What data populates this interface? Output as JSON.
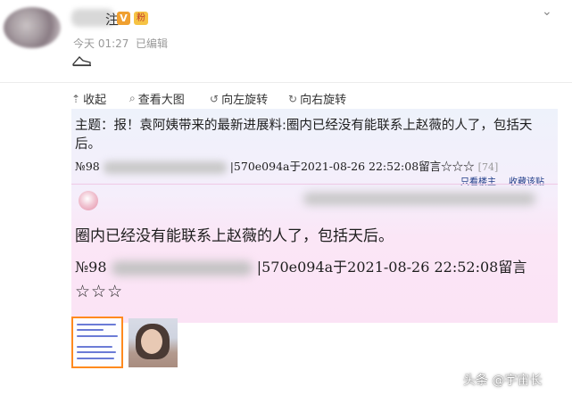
{
  "header": {
    "username_tail": "注",
    "vip_badge": "V",
    "fan_badge": "粉",
    "time": "今天 01:27",
    "edited": "已编辑"
  },
  "toolbar": {
    "collapse": "收起",
    "view_large": "查看大图",
    "rotate_left": "向左旋转",
    "rotate_right": "向右旋转"
  },
  "post_image": {
    "topic": "主题：报！袁阿姨带来的最新进展料:圈内已经没有能联系上赵薇的人了，包括天后。",
    "meta_small_prefix": "№98",
    "meta_small_suffix": "|570e094a于2021-08-26 22:52:08留言☆☆☆",
    "meta_small_count": "[74]",
    "link_only_op": "只看楼主",
    "link_favorite": "收藏该贴",
    "quote": "圈内已经没有能联系上赵薇的人了，包括天后。",
    "meta_large_prefix": "№98",
    "meta_large_suffix": "|570e094a于2021-08-26 22:52:08留言",
    "stars": "☆☆☆"
  },
  "watermark": "头条 @宇宙长",
  "colors": {
    "thumb_border": "#ff8a1f",
    "link": "#1f3c88",
    "panel_pink": "#fbe3f5"
  }
}
